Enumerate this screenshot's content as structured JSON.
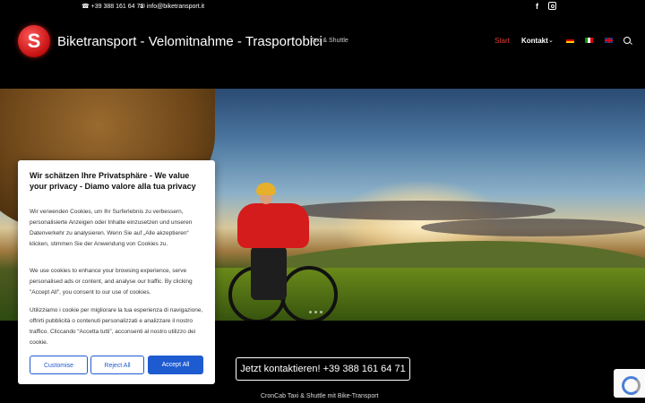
{
  "topbar": {
    "phone": "+39 388 161 64 71",
    "email": "info@biketransport.it"
  },
  "header": {
    "site_title": "Biketransport - Velomitnahme - Trasportobici",
    "tagline": "Taxi & Shuttle",
    "nav": {
      "start": "Start",
      "kontakt": "Kontakt"
    },
    "icons": [
      "facebook-icon",
      "instagram-icon",
      "flag-de-icon",
      "flag-it-icon",
      "flag-en-icon",
      "search-icon"
    ]
  },
  "colors": {
    "accent": "#e53935",
    "button_blue": "#1e5bd1"
  },
  "cookie": {
    "title": "Wir schätzen Ihre Privatsphäre - We value your privacy - Diamo valore alla tua privacy",
    "p1": "Wir verwenden Cookies, um Ihr Surferlebnis zu verbessern, personalisierte Anzeigen oder Inhalte einzusetzen und unseren Datenverkehr zu analysieren. Wenn Sie auf „Alle akzeptieren“ klicken, stimmen Sie der Anwendung von Cookies zu.",
    "p2": "We use cookies to enhance your browsing experience, serve personalised ads or content, and analyse our traffic. By clicking \"Accept All\", you consent to our use of cookies.",
    "p3": "Utilizziamo i cookie per migliorare la tua esperienza di navigazione, offrirti pubblicità o contenuti personalizzati e analizzare il nostro traffico. Cliccando “Accetta tutti”, acconsenti al nostro utilizzo dei cookie.",
    "customise": "Customise",
    "reject": "Reject All",
    "accept": "Accept All"
  },
  "cta": "Jetzt kontaktieren! +39 388 161 64 71",
  "footer_text": "CronCab Taxi & Shuttle mit Bike-Transport"
}
